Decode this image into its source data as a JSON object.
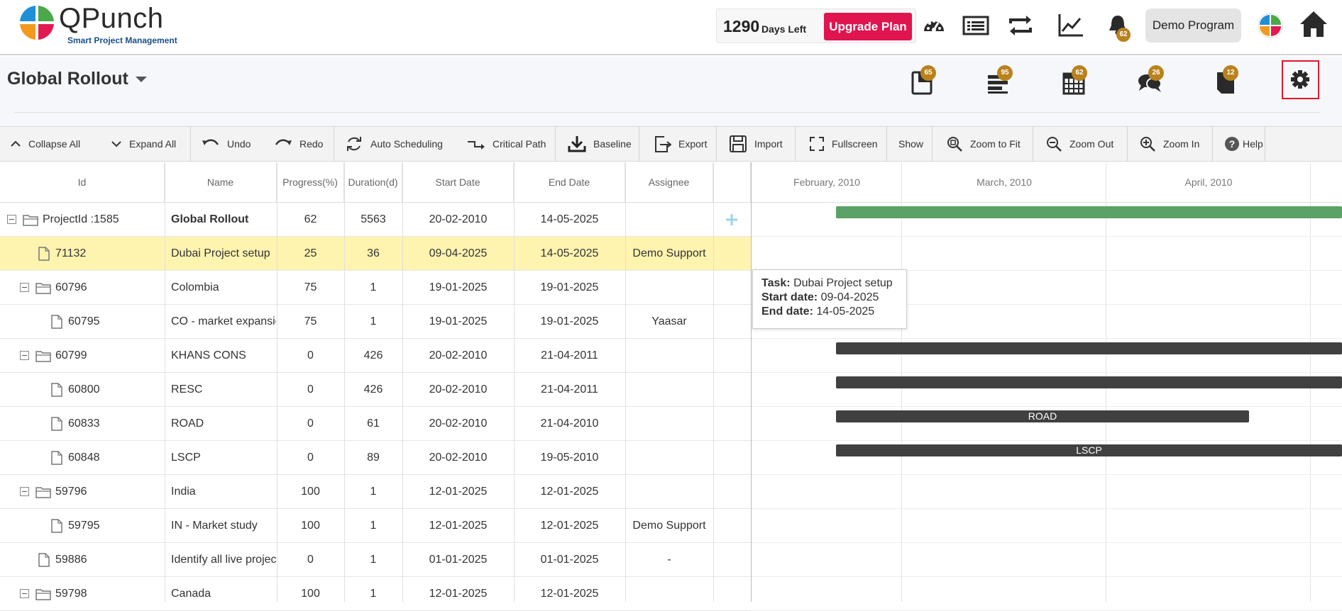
{
  "header": {
    "brand": "QPunch",
    "tagline": "Smart Project Management",
    "days_left": "1290",
    "days_left_label": "Days Left",
    "upgrade_label": "Upgrade Plan",
    "notifications_count": "62",
    "program_label": "Demo Program"
  },
  "project": {
    "title": "Global Rollout",
    "badges": {
      "tasks": "65",
      "list": "95",
      "calendar": "62",
      "chat": "26",
      "notes": "12"
    }
  },
  "toolbar": {
    "collapse_all": "Collapse All",
    "expand_all": "Expand All",
    "undo": "Undo",
    "redo": "Redo",
    "auto_scheduling": "Auto Scheduling",
    "critical_path": "Critical Path",
    "baseline": "Baseline",
    "export": "Export",
    "import": "Import",
    "fullscreen": "Fullscreen",
    "show": "Show",
    "zoom_to_fit": "Zoom to Fit",
    "zoom_out": "Zoom Out",
    "zoom_in": "Zoom In",
    "help": "Help"
  },
  "grid": {
    "columns": [
      "Id",
      "Name",
      "Progress(%)",
      "Duration(d)",
      "Start Date",
      "End Date",
      "Assignee"
    ],
    "rows": [
      {
        "id": "ProjectId :1585",
        "name": "Global Rollout",
        "progress": "62",
        "duration": "5563",
        "start": "20-02-2010",
        "end": "14-05-2025",
        "assignee": ""
      },
      {
        "id": "71132",
        "name": "Dubai Project setup",
        "progress": "25",
        "duration": "36",
        "start": "09-04-2025",
        "end": "14-05-2025",
        "assignee": "Demo Support"
      },
      {
        "id": "60796",
        "name": "Colombia",
        "progress": "75",
        "duration": "1",
        "start": "19-01-2025",
        "end": "19-01-2025",
        "assignee": ""
      },
      {
        "id": "60795",
        "name": "CO - market expansion",
        "progress": "75",
        "duration": "1",
        "start": "19-01-2025",
        "end": "19-01-2025",
        "assignee": "Yaasar"
      },
      {
        "id": "60799",
        "name": "KHANS CONS",
        "progress": "0",
        "duration": "426",
        "start": "20-02-2010",
        "end": "21-04-2011",
        "assignee": ""
      },
      {
        "id": "60800",
        "name": "RESC",
        "progress": "0",
        "duration": "426",
        "start": "20-02-2010",
        "end": "21-04-2011",
        "assignee": ""
      },
      {
        "id": "60833",
        "name": "ROAD",
        "progress": "0",
        "duration": "61",
        "start": "20-02-2010",
        "end": "21-04-2010",
        "assignee": ""
      },
      {
        "id": "60848",
        "name": "LSCP",
        "progress": "0",
        "duration": "89",
        "start": "20-02-2010",
        "end": "19-05-2010",
        "assignee": ""
      },
      {
        "id": "59796",
        "name": "India",
        "progress": "100",
        "duration": "1",
        "start": "12-01-2025",
        "end": "12-01-2025",
        "assignee": ""
      },
      {
        "id": "59795",
        "name": "IN - Market study",
        "progress": "100",
        "duration": "1",
        "start": "12-01-2025",
        "end": "12-01-2025",
        "assignee": "Demo Support"
      },
      {
        "id": "59886",
        "name": "Identify all live projects",
        "progress": "0",
        "duration": "1",
        "start": "01-01-2025",
        "end": "01-01-2025",
        "assignee": "-"
      },
      {
        "id": "59798",
        "name": "Canada",
        "progress": "100",
        "duration": "1",
        "start": "12-01-2025",
        "end": "12-01-2025",
        "assignee": ""
      }
    ]
  },
  "gantt": {
    "months": [
      "February, 2010",
      "March, 2010",
      "April, 2010"
    ],
    "bar_labels": {
      "road": "ROAD",
      "lscp": "LSCP"
    },
    "tooltip": {
      "task_label": "Task:",
      "task": "Dubai Project setup",
      "start_label": "Start date:",
      "start": "09-04-2025",
      "end_label": "End date:",
      "end": "14-05-2025"
    }
  },
  "colors": {
    "accent": "#e0144f",
    "badge": "#b9821c",
    "selected_row": "#fff3b0",
    "bar_green": "#5aa265",
    "bar_dark": "#404040",
    "highlight_border": "#e3162c"
  }
}
